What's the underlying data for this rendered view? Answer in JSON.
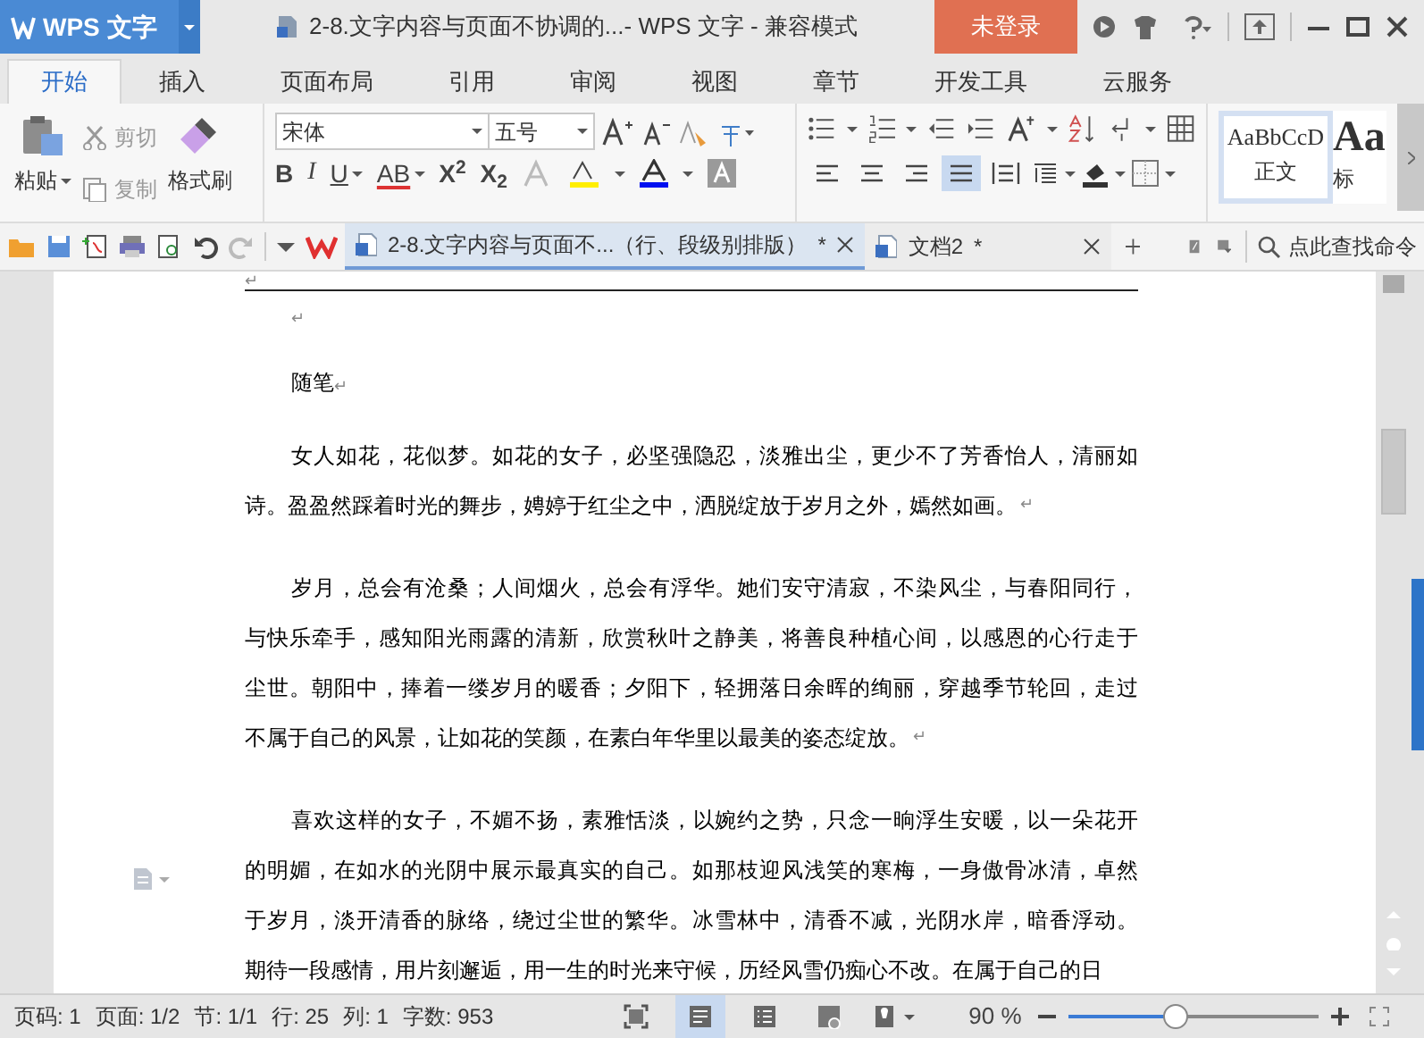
{
  "app_menu": {
    "label": "WPS 文字"
  },
  "window": {
    "title": "2-8.文字内容与页面不协调的...- WPS 文字 - 兼容模式"
  },
  "login_button": {
    "label": "未登录"
  },
  "ribbon_tabs": [
    {
      "label": "开始",
      "selected": true
    },
    {
      "label": "插入",
      "selected": false
    },
    {
      "label": "页面布局",
      "selected": false
    },
    {
      "label": "引用",
      "selected": false
    },
    {
      "label": "审阅",
      "selected": false
    },
    {
      "label": "视图",
      "selected": false
    },
    {
      "label": "章节",
      "selected": false
    },
    {
      "label": "开发工具",
      "selected": false
    },
    {
      "label": "云服务",
      "selected": false
    }
  ],
  "clipboard": {
    "paste": "粘贴",
    "cut": {
      "label": "剪切",
      "disabled": true
    },
    "copy": {
      "label": "复制",
      "disabled": true
    },
    "format_painter": "格式刷"
  },
  "font": {
    "name": "宋体",
    "size": "五号"
  },
  "format_buttons": [
    {
      "kind": "bold",
      "glyph": "B"
    },
    {
      "kind": "italic",
      "glyph": "I"
    },
    {
      "kind": "underline",
      "glyph": "U"
    },
    {
      "kind": "strike",
      "glyph": "AB"
    },
    {
      "kind": "super",
      "glyph": "X$^{2}$"
    },
    {
      "kind": "sub",
      "glyph": "X$_{2}$"
    }
  ],
  "paragraph_tools": [
    {
      "kind": "align-left",
      "selected": false
    },
    {
      "kind": "align-center",
      "selected": false
    },
    {
      "kind": "align-right",
      "selected": false
    },
    {
      "kind": "justify",
      "selected": true
    },
    {
      "kind": "distribute",
      "selected": false
    }
  ],
  "styles": [
    {
      "sample": "AaBbCcD",
      "name": "正文",
      "selected": true
    },
    {
      "sample": "Aa",
      "name": "标",
      "selected": false
    }
  ],
  "doc_tabs": [
    {
      "title": "2-8.文字内容与页面不...（行、段级别排版）",
      "modified": "*",
      "selected": true
    },
    {
      "title": "文档2",
      "modified": "*",
      "selected": false
    }
  ],
  "command_search": {
    "placeholder": "点此查找命令"
  },
  "document": {
    "header_mark": "↵",
    "blocks": [
      {
        "kind": "mark",
        "text": "↵"
      },
      {
        "kind": "heading",
        "text": "随笔",
        "mark": "↵"
      },
      {
        "kind": "paragraph",
        "lines": [
          "女人如花，花似梦。如花的女子，必坚强隐忍，淡雅出尘，更少不了芳香怡人，清丽如",
          "诗。盈盈然踩着时光的舞步，娉婷于红尘之中，洒脱绽放于岁月之外，嫣然如画。"
        ],
        "mark": "↵"
      },
      {
        "kind": "paragraph",
        "lines": [
          "岁月，总会有沧桑；人间烟火，总会有浮华。她们安守清寂，不染风尘，与春阳同行，",
          "与快乐牵手，感知阳光雨露的清新，欣赏秋叶之静美，将善良种植心间，以感恩的心行走于",
          "尘世。朝阳中，捧着一缕岁月的暖香；夕阳下，轻拥落日余晖的绚丽，穿越季节轮回，走过",
          "不属于自己的风景，让如花的笑颜，在素白年华里以最美的姿态绽放。"
        ],
        "mark": "↵"
      },
      {
        "kind": "paragraph",
        "lines": [
          "喜欢这样的女子，不媚不扬，素雅恬淡，以婉约之势，只念一晌浮生安暖，以一朵花开",
          "的明媚，在如水的光阴中展示最真实的自己。如那枝迎风浅笑的寒梅，一身傲骨冰清，卓然",
          "于岁月，淡开清香的脉络，绕过尘世的繁华。冰雪林中，清香不减，光阴水岸，暗香浮动。",
          "期待一段感情，用片刻邂逅，用一生的时光来守候，历经风雪仍痴心不改。在属于自己的日"
        ]
      }
    ]
  },
  "status_bar": {
    "fields": [
      "页码: 1",
      "页面: 1/2",
      "节: 1/1",
      "行: 25",
      "列: 1",
      "字数: 953"
    ],
    "views": [
      {
        "kind": "focus",
        "selected": false
      },
      {
        "kind": "page",
        "selected": true
      },
      {
        "kind": "outline",
        "selected": false
      },
      {
        "kind": "web",
        "selected": false
      }
    ],
    "zoom": "90 %",
    "zoom_slider": {
      "level": 0.43
    }
  }
}
